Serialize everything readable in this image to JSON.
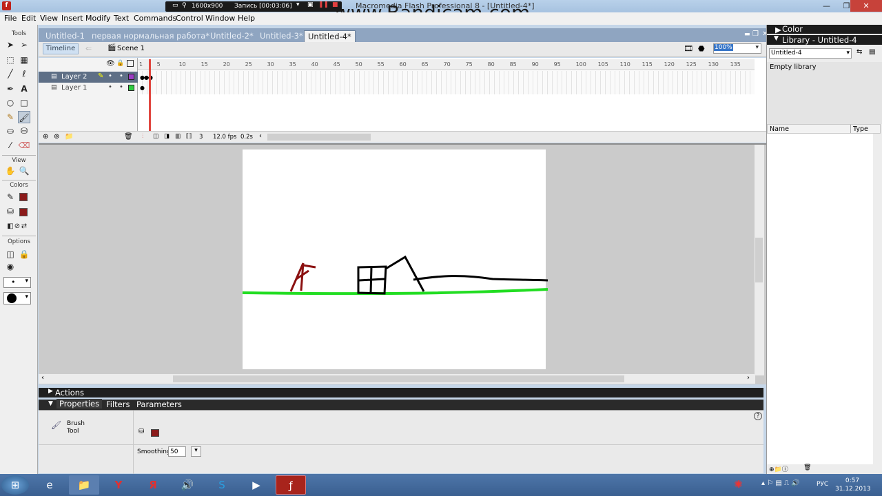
{
  "window": {
    "title": "Macromedia Flash Professional 8 - [Untitled-4*]",
    "app_icon": "flash-icon"
  },
  "recorder": {
    "resolution": "1600x900",
    "status": "Запись [00:03:06]",
    "watermark": "www.Bandicam.com"
  },
  "menubar": [
    "File",
    "Edit",
    "View",
    "Insert",
    "Modify",
    "Text",
    "Commands",
    "Control",
    "Window",
    "Help"
  ],
  "tools": {
    "label": "Tools",
    "view_label": "View",
    "colors_label": "Colors",
    "options_label": "Options",
    "stroke_color": "#8b1a1a",
    "fill_color": "#8b1a1a"
  },
  "doc_tabs": [
    "Untitled-1",
    "первая нормальная работа*",
    "Untitled-2*",
    "Untitled-3*",
    "Untitled-4*"
  ],
  "timeline": {
    "button": "Timeline",
    "scene": "Scene 1",
    "zoom": "100%",
    "layers": [
      {
        "name": "Layer 2",
        "color": "#9b3cc4",
        "selected": true
      },
      {
        "name": "Layer 1",
        "color": "#2ecc40",
        "selected": false
      }
    ],
    "ruler": [
      "1",
      "5",
      "10",
      "15",
      "20",
      "25",
      "30",
      "35",
      "40",
      "45",
      "50",
      "55",
      "60",
      "65",
      "70",
      "75",
      "80",
      "85",
      "90",
      "95",
      "100",
      "105",
      "110",
      "115",
      "120",
      "125",
      "130",
      "135"
    ],
    "current_frame": "3",
    "fps": "12.0 fps",
    "time": "0.2s"
  },
  "panels": {
    "actions": "Actions",
    "properties_tabs": [
      "Properties",
      "Filters",
      "Parameters"
    ],
    "tool_name_1": "Brush",
    "tool_name_2": "Tool",
    "smoothing_label": "Smoothing",
    "smoothing_value": "50"
  },
  "right_panel": {
    "color_title": "Color",
    "library_title": "Library - Untitled-4",
    "library_select": "Untitled-4",
    "empty_text": "Empty library",
    "col_name": "Name",
    "col_type": "Type"
  },
  "taskbar": {
    "lang": "РУС",
    "time": "0:57",
    "date": "31.12.2013",
    "apps": [
      "start-orb-icon",
      "ie-icon",
      "explorer-icon",
      "yandex-icon",
      "yandex-browser-icon",
      "audio-icon",
      "skype-icon",
      "media-icon",
      "flash-icon"
    ]
  }
}
